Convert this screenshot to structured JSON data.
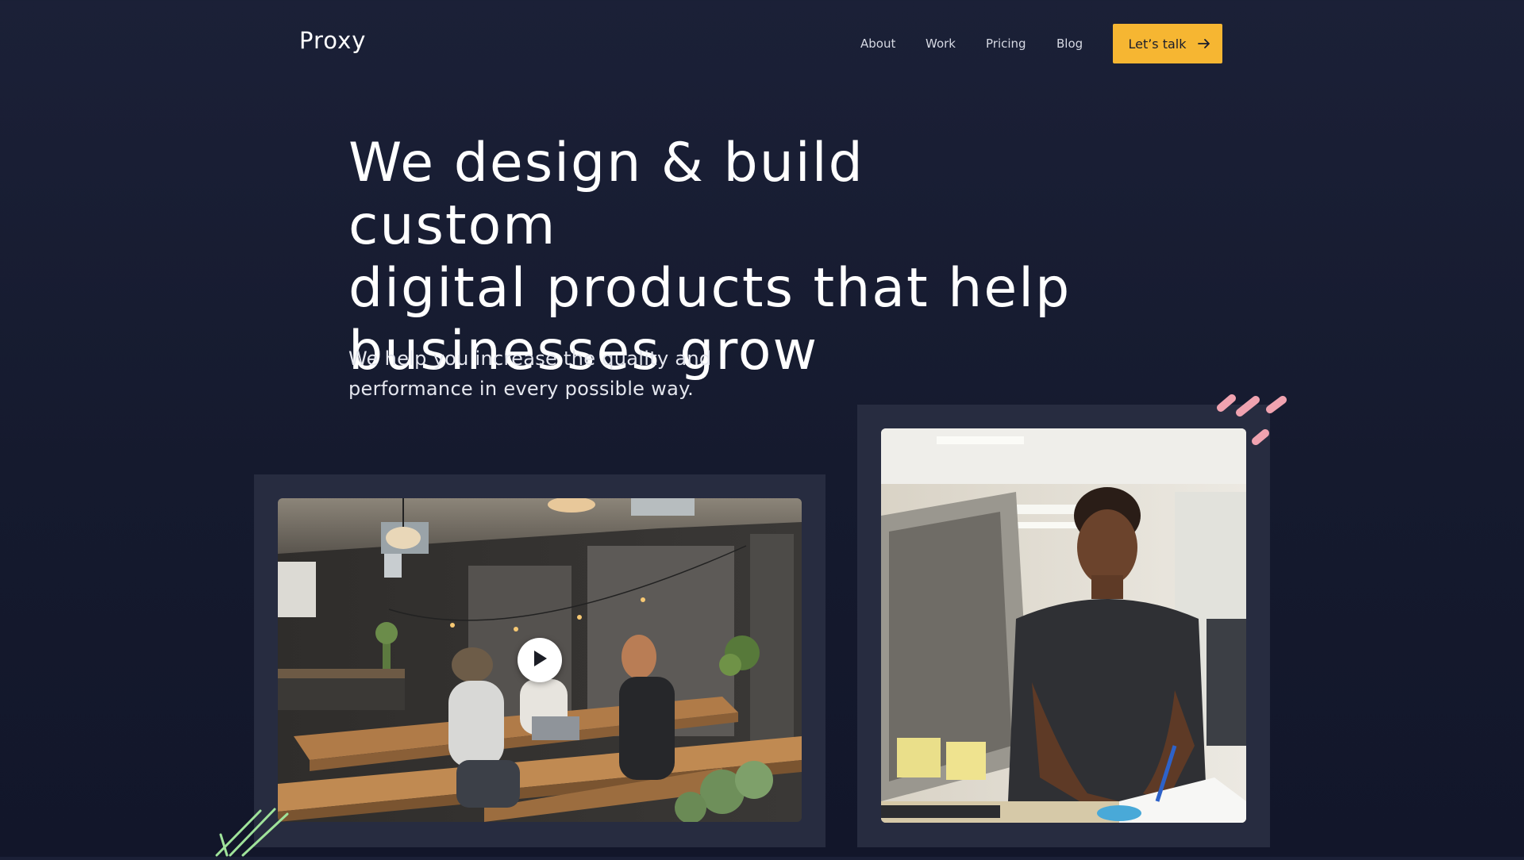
{
  "brand": {
    "name": "Proxy"
  },
  "nav": {
    "links": [
      "About",
      "Work",
      "Pricing",
      "Blog"
    ],
    "cta_label": "Let’s talk",
    "cta_color": "#f6b632"
  },
  "hero": {
    "headline_lines": [
      "We design & build custom",
      "digital products that help",
      "businesses grow"
    ],
    "subtitle_lines": [
      "We help you increase the quality and",
      "performance in every possible way."
    ]
  },
  "media": {
    "video_play_icon": "play-icon",
    "left_photo": "team-meeting-photo",
    "right_photo": "man-writing-photo"
  },
  "colors": {
    "background": "#1b2037",
    "frame": "#272c40",
    "accent_yellow": "#f6b632",
    "accent_pink": "#f0a3b0",
    "accent_green": "#9fe39a"
  }
}
